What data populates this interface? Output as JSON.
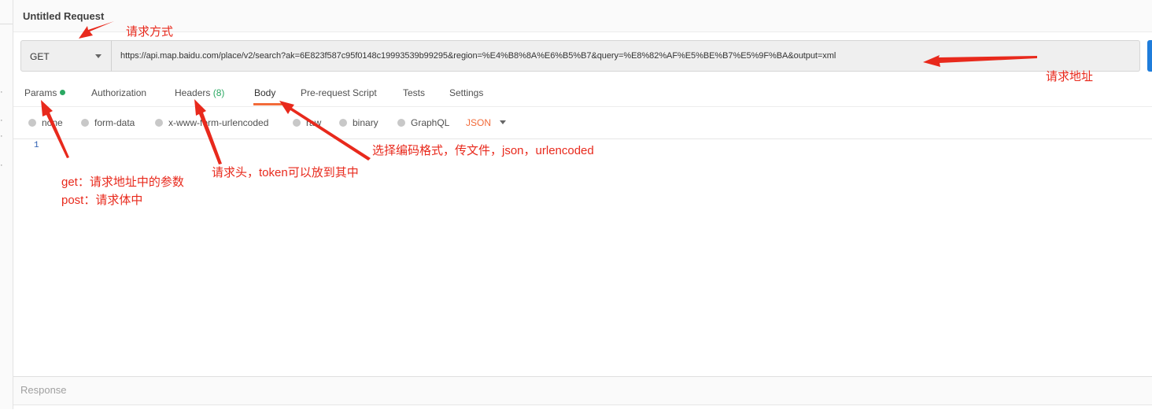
{
  "window": {
    "title": "Untitled Request"
  },
  "request": {
    "method": "GET",
    "url": "https://api.map.baidu.com/place/v2/search?ak=6E823f587c95f0148c19993539b99295&region=%E4%B8%8A%E6%B5%B7&query=%E8%82%AF%E5%BE%B7%E5%9F%BA&output=xml"
  },
  "tabs": [
    {
      "label": "Params"
    },
    {
      "label": "Authorization"
    },
    {
      "label": "Headers"
    },
    {
      "label": "Body"
    },
    {
      "label": "Pre-request Script"
    },
    {
      "label": "Tests"
    },
    {
      "label": "Settings"
    }
  ],
  "headers_count": "(8)",
  "body_options": [
    {
      "label": "none"
    },
    {
      "label": "form-data"
    },
    {
      "label": "x-www-form-urlencoded"
    },
    {
      "label": "raw"
    },
    {
      "label": "binary"
    },
    {
      "label": "GraphQL"
    }
  ],
  "body_format": "JSON",
  "editor": {
    "line_number": "1"
  },
  "response": {
    "label": "Response"
  },
  "annotations": {
    "method": "请求方式",
    "url": "请求地址",
    "body_format": "选择编码格式，传文件，json，urlencoded",
    "headers": "请求头，token可以放到其中",
    "params_get": "get：请求地址中的参数",
    "params_post": "post：请求体中"
  },
  "colors": {
    "accent": "#f26b3a",
    "annotation": "#e8291c",
    "status_green": "#2aa862",
    "send_blue": "#1f7ddb"
  }
}
